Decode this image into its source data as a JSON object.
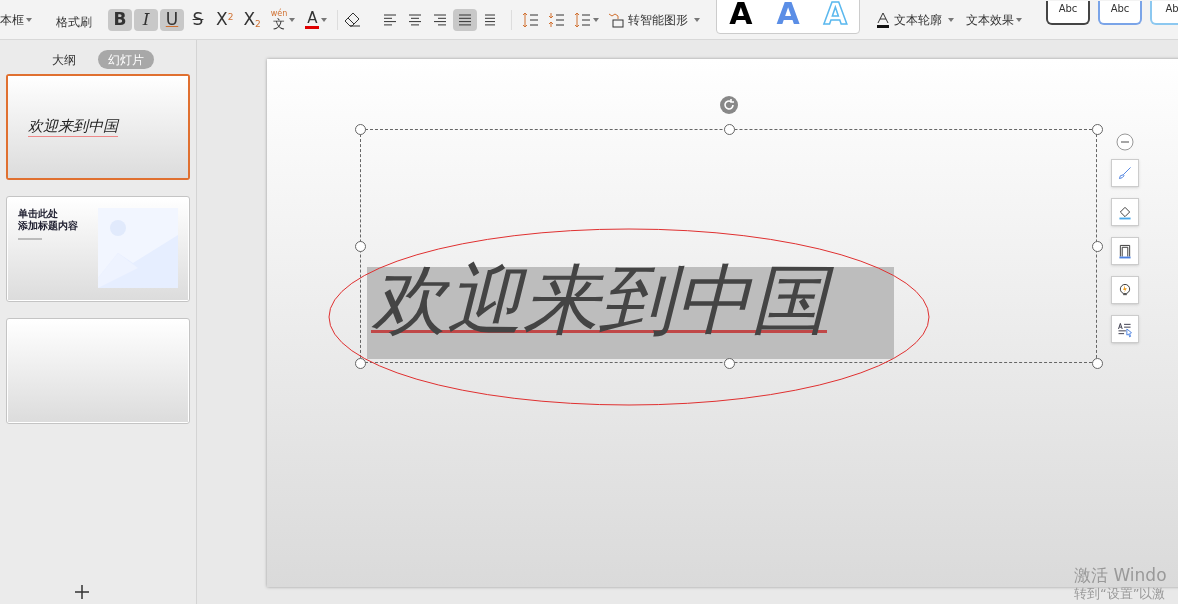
{
  "toolbar": {
    "textbox_label": "本框",
    "format_painter": "格式刷",
    "font_buttons": [
      {
        "kind": "bold",
        "label": "B",
        "selected": true
      },
      {
        "kind": "italic",
        "label": "I",
        "selected": true
      },
      {
        "kind": "underline",
        "label": "U",
        "selected": true
      },
      {
        "kind": "strike",
        "label": "S",
        "selected": false
      },
      {
        "kind": "sup",
        "label": "X",
        "script": "2",
        "selected": false
      },
      {
        "kind": "sub",
        "label": "X",
        "script": "2",
        "selected": false
      },
      {
        "kind": "pinyin",
        "label": "文",
        "script": "wén",
        "selected": false
      },
      {
        "kind": "color",
        "label": "A",
        "selected": false
      }
    ],
    "align_buttons": [
      {
        "kind": "left",
        "selected": false
      },
      {
        "kind": "center",
        "selected": false
      },
      {
        "kind": "right",
        "selected": false
      },
      {
        "kind": "justify",
        "selected": true
      },
      {
        "kind": "distribute",
        "selected": false
      }
    ],
    "smart_shape": "转智能图形",
    "text_styles": [
      "A",
      "A",
      "A"
    ],
    "text_outline": "文本轮廓",
    "text_effect": "文本效果",
    "shape_styles": [
      "Abc",
      "Abc",
      "Ab"
    ]
  },
  "panel_tabs": [
    {
      "label": "大纲",
      "selected": false
    },
    {
      "label": "幻灯片",
      "selected": true
    }
  ],
  "slides": [
    {
      "kind": "title",
      "text": "欢迎来到中国",
      "selected": true
    },
    {
      "kind": "template",
      "lines": [
        "单击此处",
        "添加标题内容"
      ],
      "selected": false
    },
    {
      "kind": "blank",
      "selected": false
    }
  ],
  "slide": {
    "text": "欢迎来到中国"
  },
  "os_notice": [
    "激活 Windo",
    "转到“设置”以激"
  ]
}
